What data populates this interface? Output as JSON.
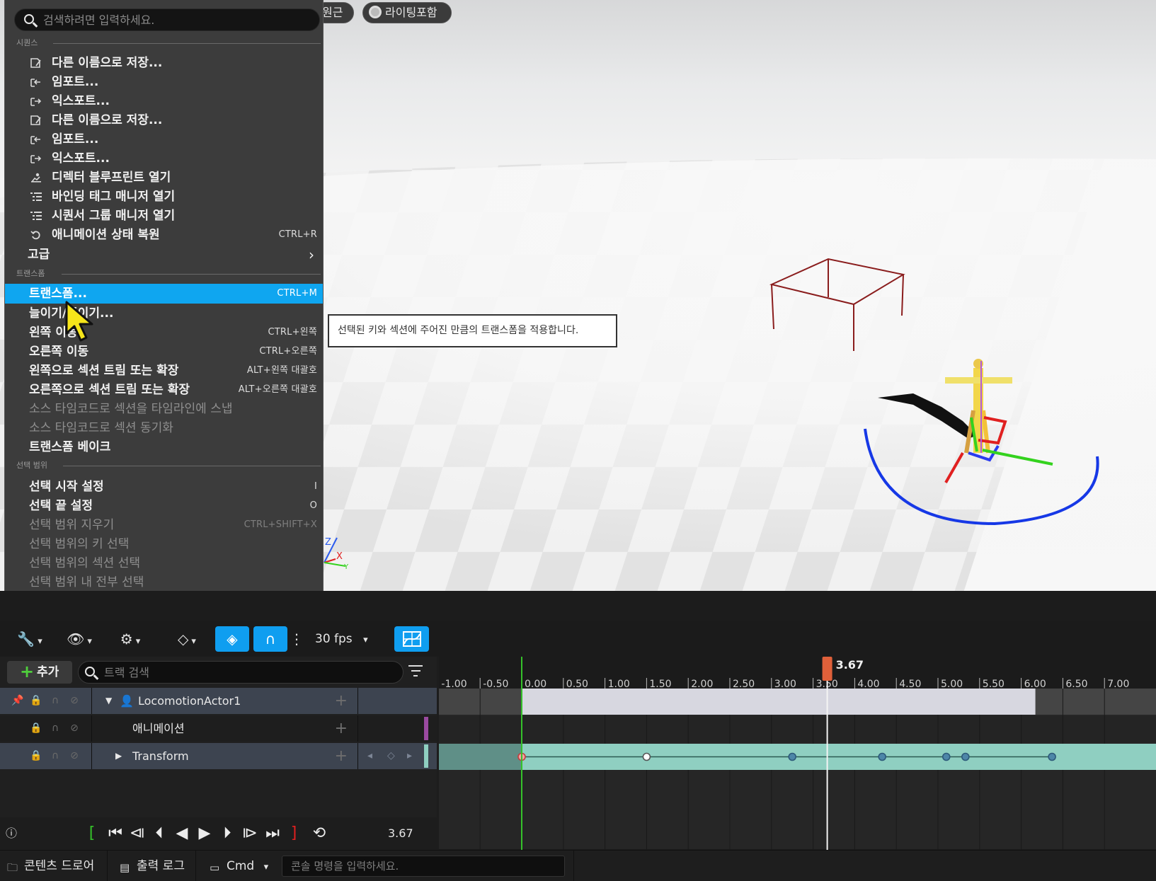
{
  "viewport": {
    "perspective_label": "원근",
    "lighting_label": "라이팅포함",
    "tooltip": "선택된 키와 섹션에 주어진 만큼의 트랜스폼을 적용합니다.",
    "gizmo_labels": {
      "z": "Z",
      "x": "X",
      "y": "Y"
    }
  },
  "menu": {
    "search_placeholder": "검색하려면 입력하세요.",
    "sections": [
      {
        "title": "시퀀스",
        "items": [
          {
            "label": "다른 이름으로 저장...",
            "icon": "save-as-icon",
            "shortcut": ""
          },
          {
            "label": "임포트...",
            "icon": "import-icon",
            "shortcut": ""
          },
          {
            "label": "익스포트...",
            "icon": "export-icon",
            "shortcut": ""
          },
          {
            "label": "다른 이름으로 저장...",
            "icon": "save-as-icon",
            "shortcut": ""
          },
          {
            "label": "임포트...",
            "icon": "import-icon",
            "shortcut": ""
          },
          {
            "label": "익스포트...",
            "icon": "export-icon",
            "shortcut": ""
          },
          {
            "label": "디렉터 블루프린트 열기",
            "icon": "director-blueprint-icon",
            "shortcut": ""
          },
          {
            "label": "바인딩 태그 매니저 열기",
            "icon": "list-icon",
            "shortcut": ""
          },
          {
            "label": "시퀀서 그룹 매니저 열기",
            "icon": "list-icon",
            "shortcut": ""
          },
          {
            "label": "애니메이션 상태 복원",
            "icon": "restore-icon",
            "shortcut": "CTRL+R"
          },
          {
            "label": "고급",
            "submenu": true
          }
        ]
      },
      {
        "title": "트랜스폼",
        "items": [
          {
            "label": "트랜스폼...",
            "shortcut": "CTRL+M",
            "state": "highlight"
          },
          {
            "label": "늘이기/줄이기...",
            "shortcut": ""
          },
          {
            "label": "왼쪽 이동",
            "shortcut": "CTRL+왼쪽"
          },
          {
            "label": "오른쪽 이동",
            "shortcut": "CTRL+오른쪽"
          },
          {
            "label": "왼쪽으로 섹션 트림 또는 확장",
            "shortcut": "ALT+왼쪽 대괄호"
          },
          {
            "label": "오른쪽으로 섹션 트림 또는 확장",
            "shortcut": "ALT+오른쪽 대괄호"
          },
          {
            "label": "소스 타임코드로 섹션을 타임라인에 스냅",
            "shortcut": "",
            "state": "disabled"
          },
          {
            "label": "소스 타임코드로 섹션 동기화",
            "shortcut": "",
            "state": "disabled"
          },
          {
            "label": "트랜스폼 베이크",
            "shortcut": ""
          }
        ]
      },
      {
        "title": "선택 범위",
        "items": [
          {
            "label": "선택 시작 설정",
            "shortcut": "I"
          },
          {
            "label": "선택 끝 설정",
            "shortcut": "O"
          },
          {
            "label": "선택 범위 지우기",
            "shortcut": "CTRL+SHIFT+X",
            "state": "disabled"
          },
          {
            "label": "선택 범위의 키 선택",
            "shortcut": "",
            "state": "disabled"
          },
          {
            "label": "선택 범위의 섹션 선택",
            "shortcut": "",
            "state": "disabled"
          },
          {
            "label": "선택 범위 내 전부 선택",
            "shortcut": "",
            "state": "disabled"
          }
        ]
      }
    ]
  },
  "sequencer": {
    "fps": "30 fps",
    "add_label": "추가",
    "track_search_placeholder": "트랙 검색",
    "tracks": [
      {
        "name": "LocomotionActor1",
        "kind": "actor"
      },
      {
        "name": "애니메이션",
        "kind": "animation"
      },
      {
        "name": "Transform",
        "kind": "transform"
      }
    ],
    "ruler_ticks": [
      "-1.00",
      "-0.50",
      "0.00",
      "0.50",
      "1.00",
      "1.50",
      "2.00",
      "2.50",
      "3.00",
      "3.50",
      "4.00",
      "4.50",
      "5.00",
      "5.50",
      "6.00",
      "6.50",
      "7.00"
    ],
    "playhead_time": 3.67,
    "playhead_label": "3.67",
    "section_range": [
      0.0,
      6.17
    ],
    "transform_keys": [
      0.0,
      1.5,
      3.25,
      4.33,
      5.1,
      5.33,
      6.37
    ],
    "current_time": "3.67",
    "colors": {
      "accent": "#0fa6f0",
      "playhead": "#e0603a",
      "transform_track": "#8fcfc1",
      "start_marker": "#35c22a",
      "end_marker": "#e02020"
    }
  },
  "statusbar": {
    "content_drawer": "콘텐츠 드로어",
    "output_log": "출력 로그",
    "cmd_label": "Cmd",
    "cmd_placeholder": "콘솔 명령을 입력하세요."
  }
}
